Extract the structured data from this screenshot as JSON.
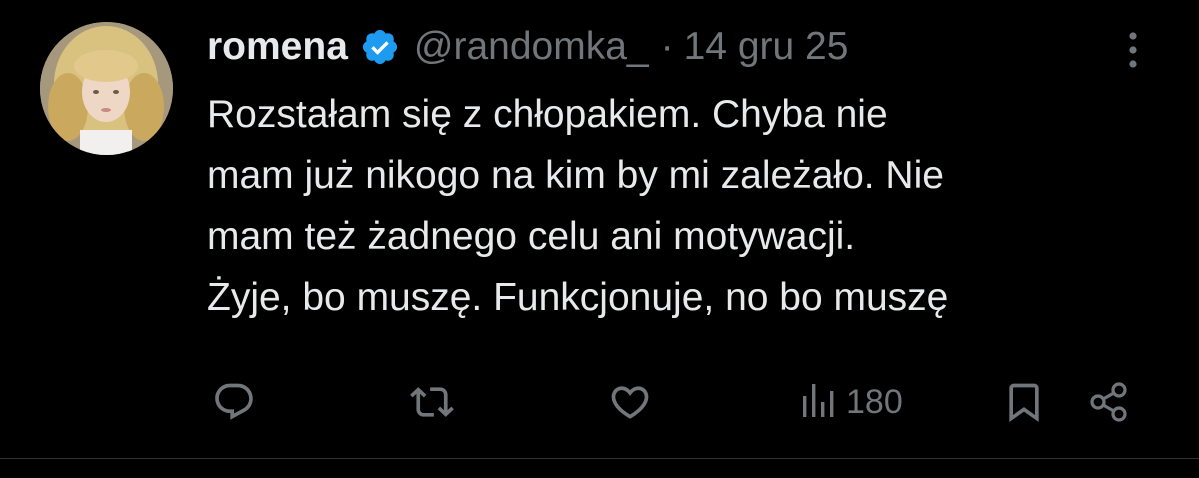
{
  "tweet": {
    "author_name": "romena",
    "handle": "@randomka_",
    "separator": "·",
    "date": "14 gru 25",
    "text": "Rozstałam się z chłopakiem. Chyba nie\nmam już nikogo na kim by mi zależało. Nie\nmam też żadnego celu ani motywacji.\nŻyje, bo muszę. Funkcjonuje, no bo muszę",
    "views": "180"
  },
  "icons": {
    "verified": "verified-badge-icon",
    "more": "more-vertical-icon",
    "reply": "reply-bubble-icon",
    "retweet": "retweet-icon",
    "like": "heart-icon",
    "views": "bar-chart-icon",
    "bookmark": "bookmark-icon",
    "share": "share-icon"
  },
  "colors": {
    "background": "#000000",
    "primary_text": "#e7e9ea",
    "secondary_text": "#71767b",
    "verified_blue": "#1d9bf0",
    "divider": "#2f3336"
  }
}
